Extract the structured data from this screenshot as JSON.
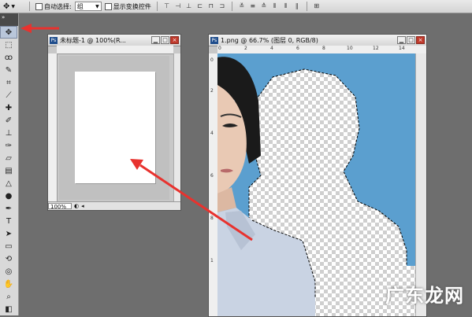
{
  "options_bar": {
    "auto_select_label": "自动选择:",
    "auto_select_value": "组",
    "show_transform_label": "显示变换控件",
    "align_icons": [
      "align-top-icon",
      "align-vcenter-icon",
      "align-bottom-icon",
      "align-left-icon",
      "align-hcenter-icon",
      "align-right-icon",
      "distribute-top-icon",
      "distribute-vcenter-icon",
      "distribute-bottom-icon",
      "distribute-left-icon",
      "distribute-hcenter-icon",
      "distribute-right-icon",
      "auto-align-icon"
    ]
  },
  "toolbox": {
    "grip_label": "»",
    "tools": [
      "move",
      "marquee",
      "lasso",
      "quick-select",
      "crop",
      "eyedropper",
      "healing-brush",
      "brush",
      "clone-stamp",
      "history-brush",
      "eraser",
      "gradient",
      "blur",
      "dodge",
      "pen",
      "type",
      "path-select",
      "shape",
      "3d-rotate",
      "3d-orbit",
      "hand",
      "zoom",
      "color-swatches"
    ]
  },
  "doc_small": {
    "ps_badge": "Ps",
    "title": "未标题-1 @ 100%(R...",
    "zoom": "100%"
  },
  "doc_main": {
    "ps_badge": "Ps",
    "title": "1.png @ 66.7% (图层 0, RGB/8)",
    "ruler_h": [
      "0",
      "2",
      "4",
      "6",
      "8",
      "10",
      "12",
      "14"
    ],
    "ruler_v": [
      "0",
      "2",
      "4",
      "6",
      "8",
      "1"
    ],
    "bg_color": "#5b9fcf"
  },
  "window_buttons": {
    "minimize": "▁",
    "restore": "□",
    "close": "×"
  },
  "watermark": "广东龙网"
}
